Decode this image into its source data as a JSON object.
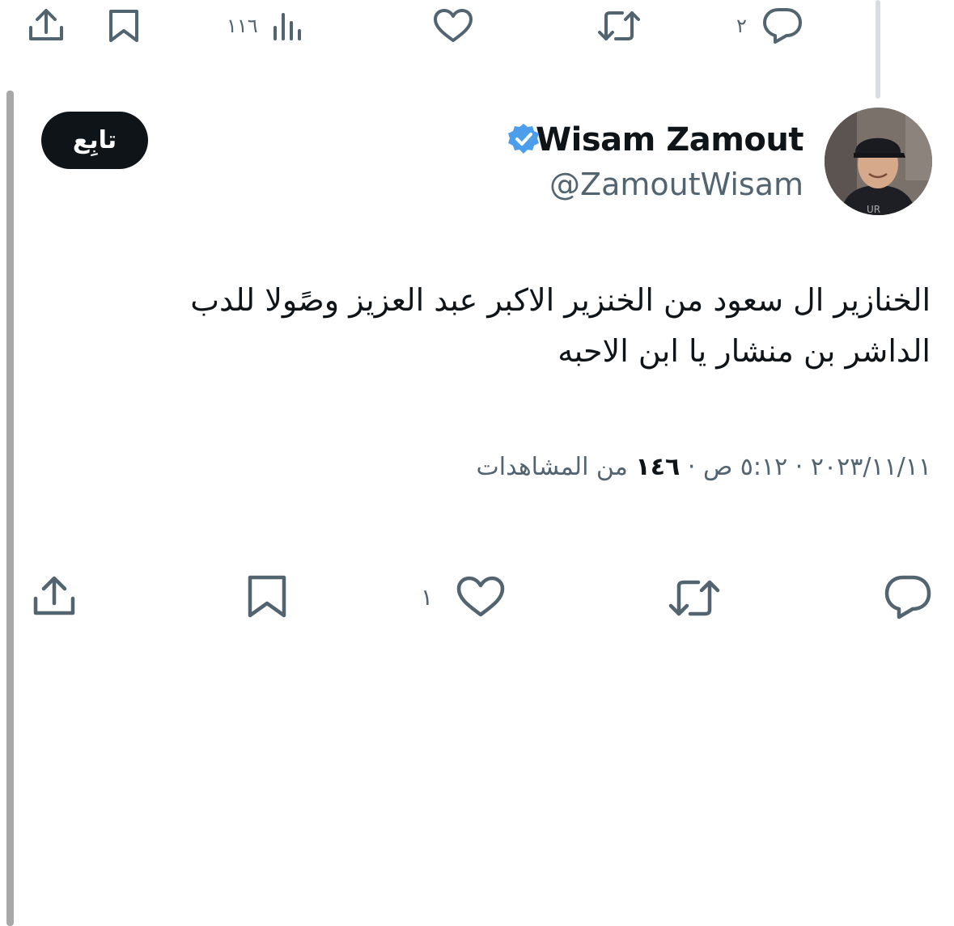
{
  "previous_tweet_actions": {
    "reply_count": "٢",
    "views_count": "١١٦"
  },
  "tweet": {
    "author": {
      "display_name": "Wisam Zamout",
      "handle": "@ZamoutWisam",
      "verified": true,
      "verified_color": "#4c9eeb"
    },
    "follow_label": "تابِع",
    "text_lines": [
      "الخنازير ال سعود من الخنزير الاكبر عبد العزيز وصًولا للدب",
      "الداشر بن منشار يا ابن الاحبه"
    ],
    "meta": {
      "date": "٢٠٢٣/١١/١١",
      "separator": "·",
      "time": "٥:١٢ ص",
      "views": "١٤٦",
      "views_label": "من المشاهدات"
    },
    "actions": {
      "like_count": "١"
    }
  },
  "icons": {
    "top_bar": [
      "share-icon",
      "bookmark-icon",
      "views-icon",
      "like-icon",
      "retweet-icon",
      "reply-icon"
    ],
    "bottom_bar": [
      "share-icon",
      "bookmark-icon",
      "like-icon",
      "retweet-icon",
      "reply-icon"
    ]
  },
  "colors": {
    "text_primary": "#0f1419",
    "text_secondary": "#536471",
    "follow_button_bg": "#0f1419"
  }
}
